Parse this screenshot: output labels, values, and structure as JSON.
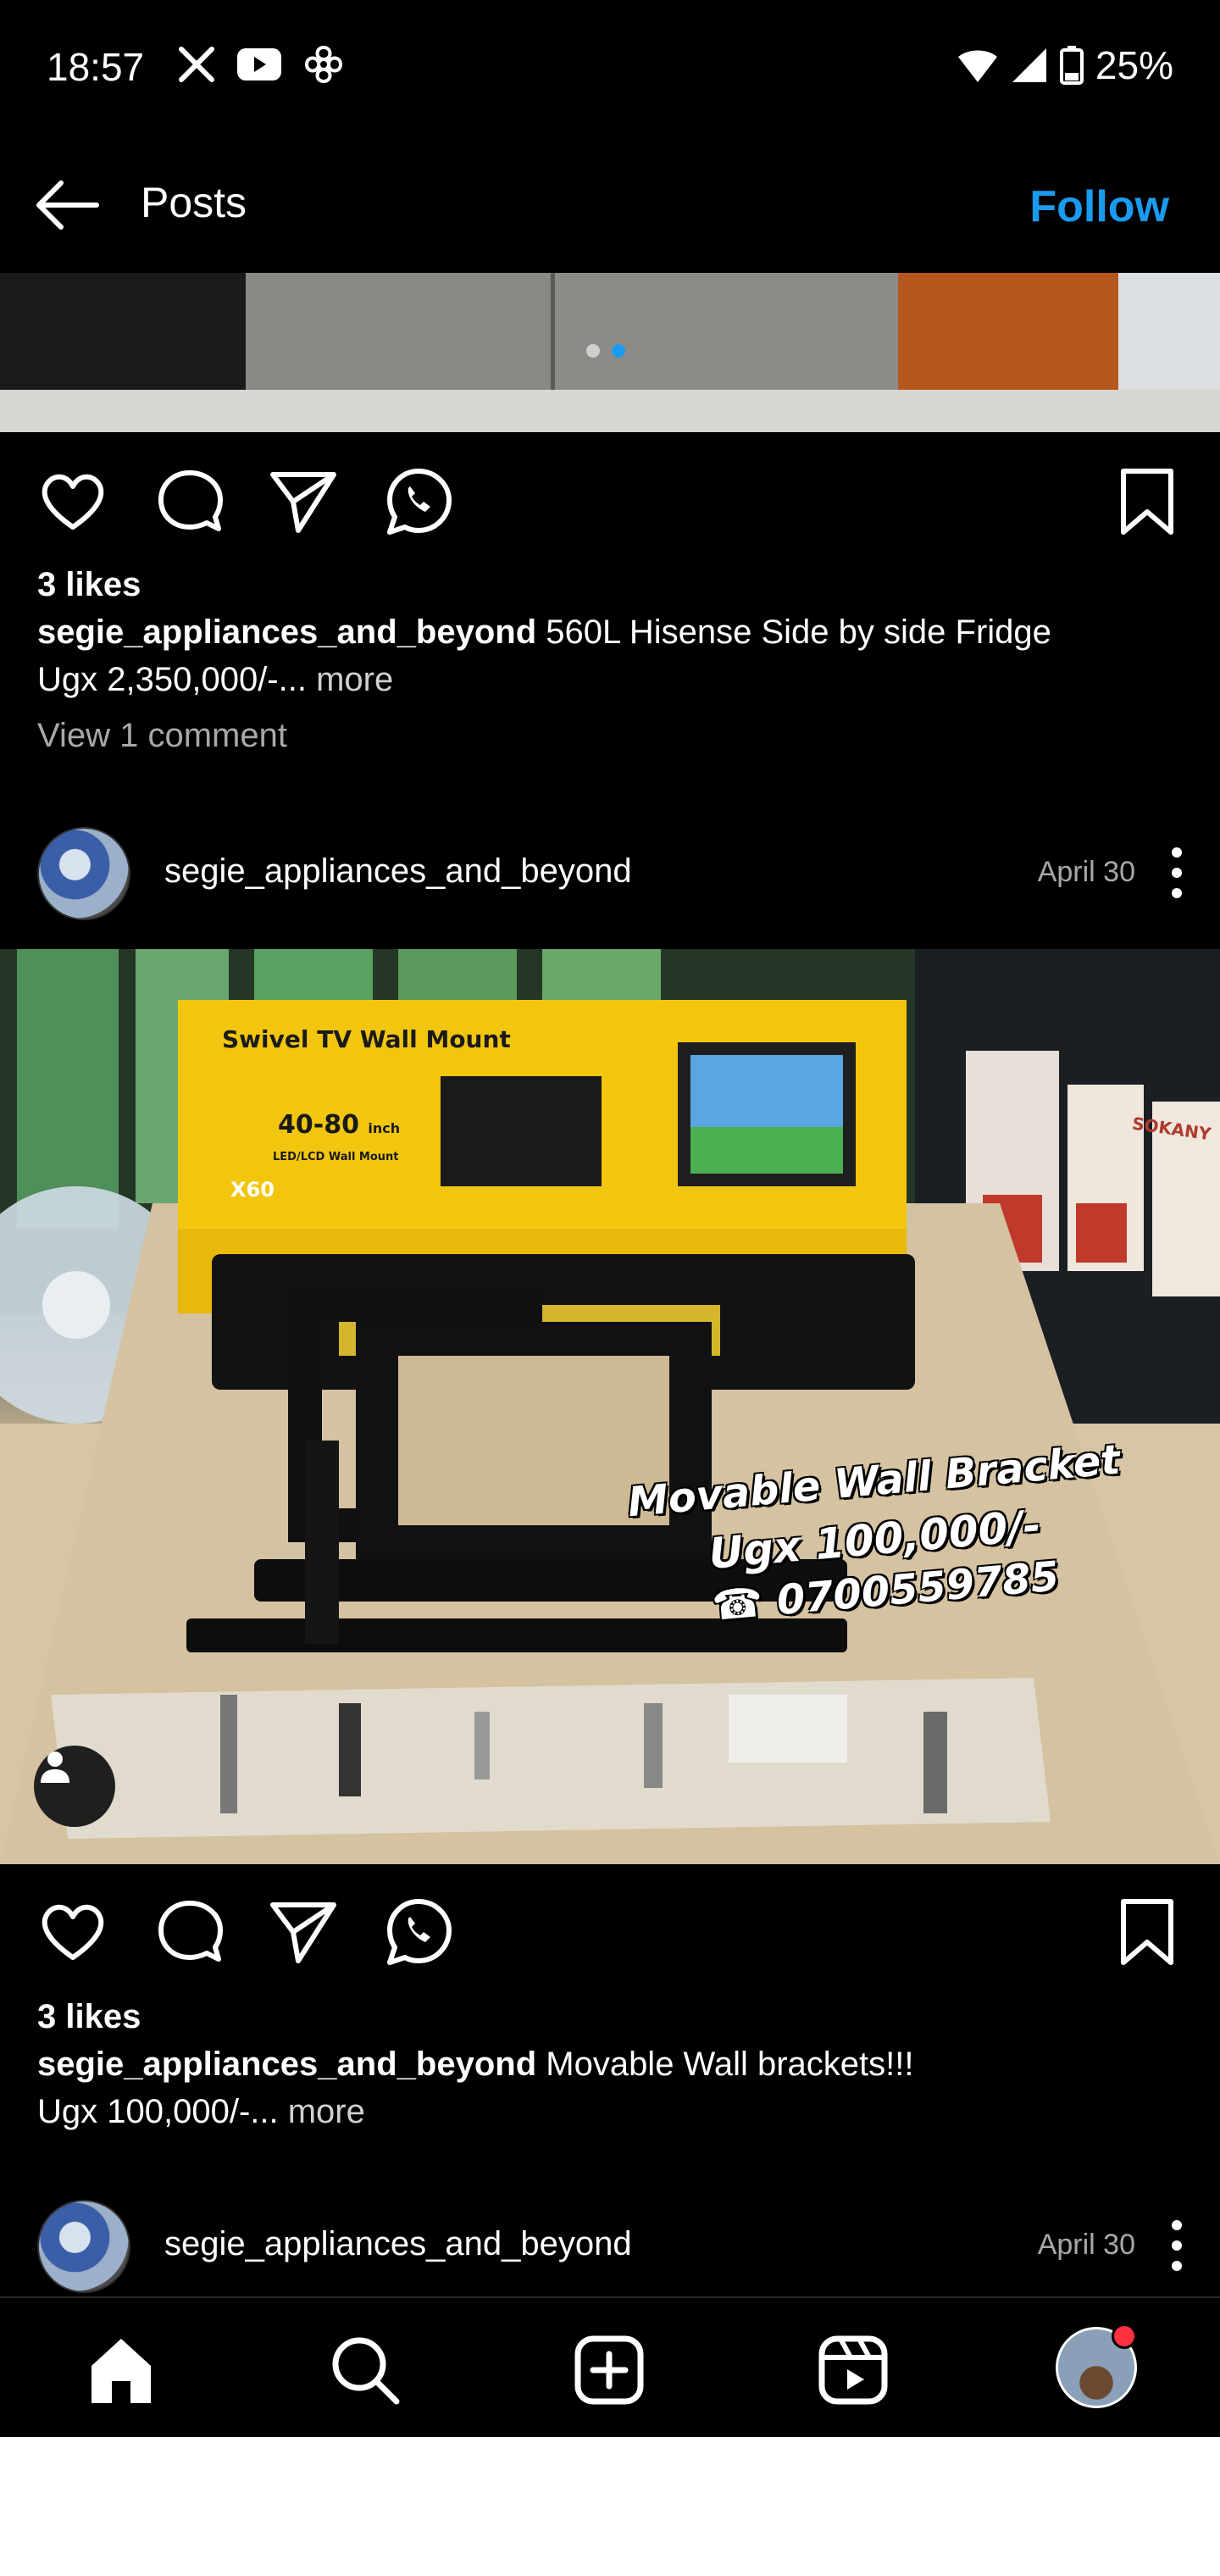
{
  "status_bar": {
    "time": "18:57",
    "battery": "25%",
    "left_icons": [
      "x-logo-icon",
      "youtube-icon",
      "threads-like-icon"
    ],
    "right_icons": [
      "wifi-icon",
      "signal-icon",
      "battery-icon"
    ]
  },
  "header": {
    "title": "Posts",
    "follow_label": "Follow"
  },
  "colors": {
    "accent": "#1a9bf0",
    "background": "#000000",
    "muted": "#a8a8a8",
    "notification": "#ff3040"
  },
  "post1": {
    "carousel_count": 2,
    "carousel_active": 2,
    "likes": "3 likes",
    "username": "segie_appliances_and_beyond",
    "caption_line1": "560L Hisense Side by side Fridge",
    "caption_line2": "Ugx 2,350,000/-...",
    "more": "more",
    "view_comments": "View 1 comment"
  },
  "post2": {
    "username": "segie_appliances_and_beyond",
    "date": "April 30",
    "image_text": {
      "box_title": "Swivel TV Wall Mount",
      "box_size": "40-80",
      "box_size_unit": "inch",
      "box_sub": "LED/LCD Wall Mount",
      "box_model": "X60",
      "overlay_line1": "Movable Wall Bracket",
      "overlay_line2": "Ugx 100,000/-",
      "overlay_phone": "☎ 0700559785",
      "brand_box": "SOKANY"
    },
    "likes": "3 likes",
    "caption_line1": "Movable Wall brackets!!!",
    "caption_line2": "Ugx 100,000/-...",
    "more": "more"
  },
  "post3": {
    "username": "segie_appliances_and_beyond",
    "date": "April 30"
  },
  "bottom_nav": [
    "home-icon",
    "search-icon",
    "create-icon",
    "reels-icon",
    "profile-avatar"
  ]
}
